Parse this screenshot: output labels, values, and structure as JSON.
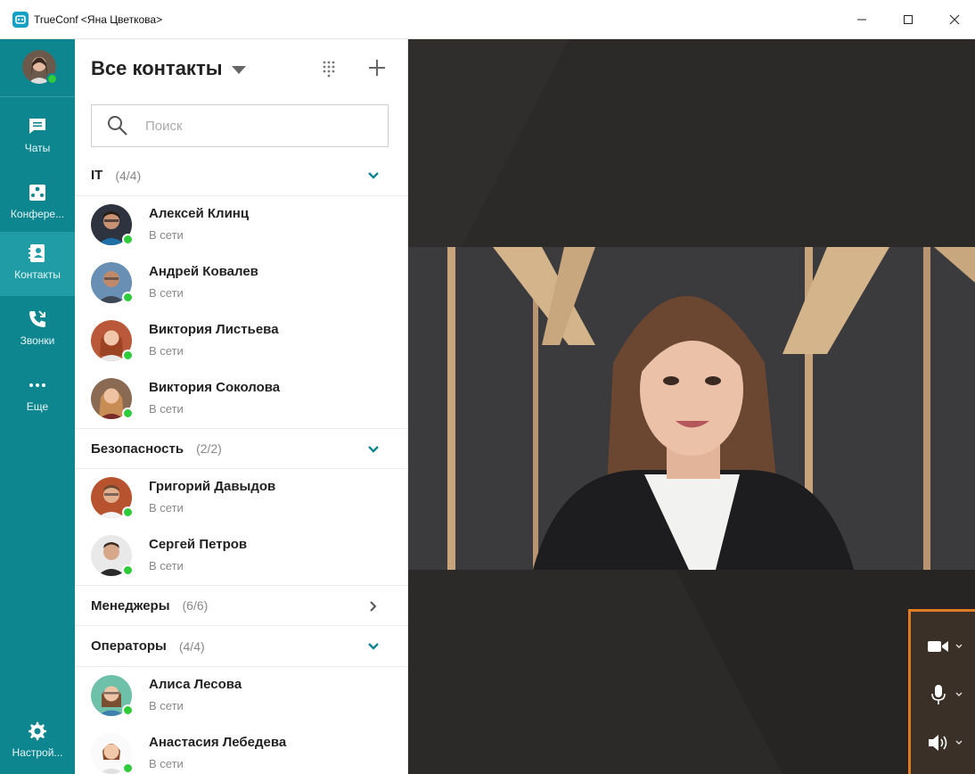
{
  "window": {
    "title": "TrueConf <Яна Цветкова>",
    "app_icon": "trueconf-logo-icon",
    "controls": [
      "minimize-icon",
      "maximize-icon",
      "close-icon"
    ]
  },
  "rail": {
    "user_status": "online",
    "items": [
      {
        "label": "Чаты",
        "icon": "chat-icon"
      },
      {
        "label": "Конфере...",
        "icon": "conference-icon"
      },
      {
        "label": "Контакты",
        "icon": "contacts-icon",
        "active": true
      },
      {
        "label": "Звонки",
        "icon": "calls-icon"
      },
      {
        "label": "Еще",
        "icon": "more-icon"
      }
    ],
    "settings": {
      "label": "Настрой...",
      "icon": "gear-icon"
    }
  },
  "contacts": {
    "title": "Все контакты",
    "search_placeholder": "Поиск",
    "groups": [
      {
        "name": "IT",
        "count": "(4/4)",
        "expanded": true,
        "members": [
          {
            "name": "Алексей Клинц",
            "status": "В сети"
          },
          {
            "name": "Андрей Ковалев",
            "status": "В сети"
          },
          {
            "name": "Виктория Листьева",
            "status": "В сети"
          },
          {
            "name": "Виктория Соколова",
            "status": "В сети"
          }
        ]
      },
      {
        "name": "Безопасность",
        "count": "(2/2)",
        "expanded": true,
        "members": [
          {
            "name": "Григорий Давыдов",
            "status": "В сети"
          },
          {
            "name": "Сергей Петров",
            "status": "В сети"
          }
        ]
      },
      {
        "name": "Менеджеры",
        "count": "(6/6)",
        "expanded": false,
        "members": []
      },
      {
        "name": "Операторы",
        "count": "(4/4)",
        "expanded": true,
        "members": [
          {
            "name": "Алиса Лесова",
            "status": "В сети"
          },
          {
            "name": "Анастасия Лебедева",
            "status": "В сети"
          }
        ]
      }
    ]
  },
  "colors": {
    "rail": "#0d8690",
    "rail_active": "#1f9ca5",
    "accent": "#0d8690",
    "online": "#2ecc3a",
    "video_bg": "#2b2a29",
    "controls_border": "#e07d22"
  },
  "media_controls": [
    {
      "icon": "camera-icon"
    },
    {
      "icon": "microphone-icon"
    },
    {
      "icon": "speaker-icon"
    }
  ]
}
